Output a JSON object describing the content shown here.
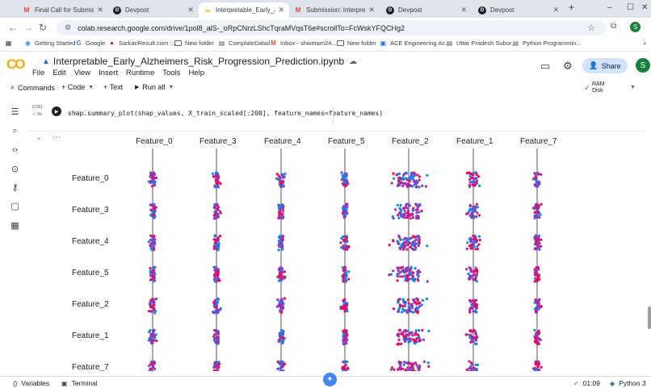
{
  "browser": {
    "tabs": [
      {
        "label": "Final Call for Submissions",
        "icon": "gmail-icon"
      },
      {
        "label": "Devpost",
        "icon": "devpost-icon"
      },
      {
        "label": "Interpretable_Early_Alzhe",
        "icon": "colab-icon",
        "active": true
      },
      {
        "label": "Submission: Interpretable",
        "icon": "gmail-icon"
      },
      {
        "label": "Devpost",
        "icon": "devpost-icon"
      },
      {
        "label": "Devpost",
        "icon": "devpost-icon"
      }
    ],
    "new_tab": "+",
    "window_controls": [
      "–",
      "☐",
      "✕"
    ],
    "url": "colab.research.google.com/drive/1pol8_alS-_oRpCNrzLShcTqraMVqsT6e#scrollTo=FcWskYFQCHg2",
    "profile_initial": "S",
    "bookmarks": [
      {
        "label": "Getting Started",
        "icon": "chrome-icon"
      },
      {
        "label": "Google",
        "icon": "google-icon"
      },
      {
        "label": "SarkariResult.com :...",
        "icon": "sarkari-icon"
      },
      {
        "label": "New folder",
        "icon": "folder-icon"
      },
      {
        "label": "ComplateDatail",
        "icon": "page-icon"
      },
      {
        "label": "Inbox - shwetam24...",
        "icon": "gmail-icon"
      },
      {
        "label": "New folder",
        "icon": "folder-icon"
      },
      {
        "label": "ACE Engineering Ac...",
        "icon": "ace-icon"
      },
      {
        "label": "Uttar Pradesh Subor...",
        "icon": "page-icon"
      },
      {
        "label": "Python Programmin...",
        "icon": "page-icon"
      }
    ],
    "more_bookmarks": "»"
  },
  "colab": {
    "logo": "CO",
    "notebook_title": "Interpretable_Early_Alzheimers_Risk_Progression_Prediction.ipynb",
    "menus": [
      "File",
      "Edit",
      "View",
      "Insert",
      "Runtime",
      "Tools",
      "Help"
    ],
    "share_label": "Share",
    "profile_initial": "S",
    "toolbar": {
      "commands": "Commands",
      "code": "+ Code",
      "text": "+ Text",
      "run_all": "Run all",
      "ram": "RAM",
      "disk": "Disk"
    }
  },
  "cell": {
    "exec_count": "[106]",
    "exec_time": "9s",
    "code": "shap.summary_plot(shap_values, X_train_scaled[:200], feature_names=feature_names)",
    "output_menu": "⋯"
  },
  "chart_data": {
    "type": "scatter",
    "title": "",
    "xlabel": "",
    "ylabel": "",
    "columns": [
      "Feature_0",
      "Feature_3",
      "Feature_4",
      "Feature_5",
      "Feature_2",
      "Feature_1",
      "Feature_7"
    ],
    "rows": [
      "Feature_0",
      "Feature_3",
      "Feature_4",
      "Feature_5",
      "Feature_2",
      "Feature_1",
      "Feature_7"
    ],
    "colors": {
      "high": "#ff0052",
      "low": "#008bfb",
      "mid": "#9c2fc0"
    },
    "grid": false,
    "legend": "none"
  },
  "statusbar": {
    "variables": "Variables",
    "terminal": "Terminal",
    "time": "01:09",
    "kernel": "Python 3"
  }
}
